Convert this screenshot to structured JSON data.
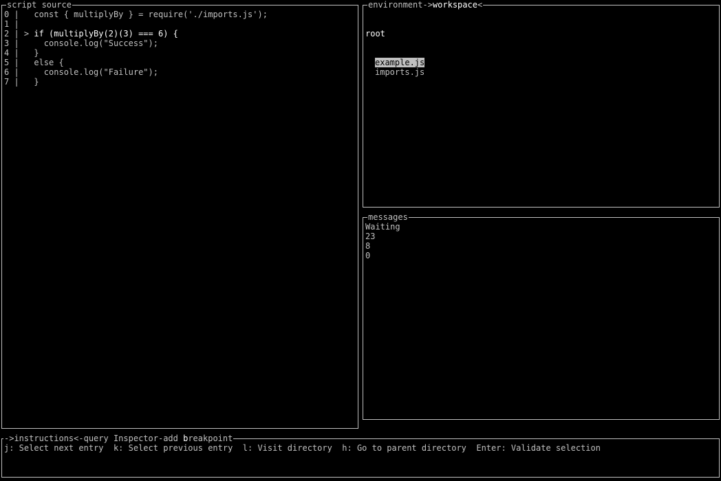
{
  "source_panel": {
    "title": "script source",
    "lines": [
      {
        "num": "0",
        "sep": " |   ",
        "marker": "",
        "code": "const { multiplyBy } = require('./imports.js');"
      },
      {
        "num": "1",
        "sep": " |",
        "marker": "",
        "code": ""
      },
      {
        "num": "2",
        "sep": " | ",
        "marker": "> ",
        "code": "if (multiplyBy(2)(3) === 6) {"
      },
      {
        "num": "3",
        "sep": " |     ",
        "marker": "",
        "code": "console.log(\"Success\");"
      },
      {
        "num": "4",
        "sep": " |   ",
        "marker": "",
        "code": "}"
      },
      {
        "num": "5",
        "sep": " |   ",
        "marker": "",
        "code": "else {"
      },
      {
        "num": "6",
        "sep": " |     ",
        "marker": "",
        "code": "console.log(\"Failure\");"
      },
      {
        "num": "7",
        "sep": " |   ",
        "marker": "",
        "code": "}"
      }
    ]
  },
  "workspace_panel": {
    "title_prefix": "environment->",
    "title_active": "workspace",
    "title_suffix": "<",
    "root": "root",
    "files": [
      "example.js",
      "imports.js"
    ],
    "selected_index": 0
  },
  "messages_panel": {
    "title": "messages",
    "items": [
      "Waiting",
      "23",
      "8",
      "0"
    ]
  },
  "instructions_panel": {
    "title_part1": "->instructions<-query Inspector-add ",
    "title_active": "b",
    "title_part2": "reakpoint",
    "text": "j: Select next entry  k: Select previous entry  l: Visit directory  h: Go to parent directory  Enter: Validate selection"
  }
}
